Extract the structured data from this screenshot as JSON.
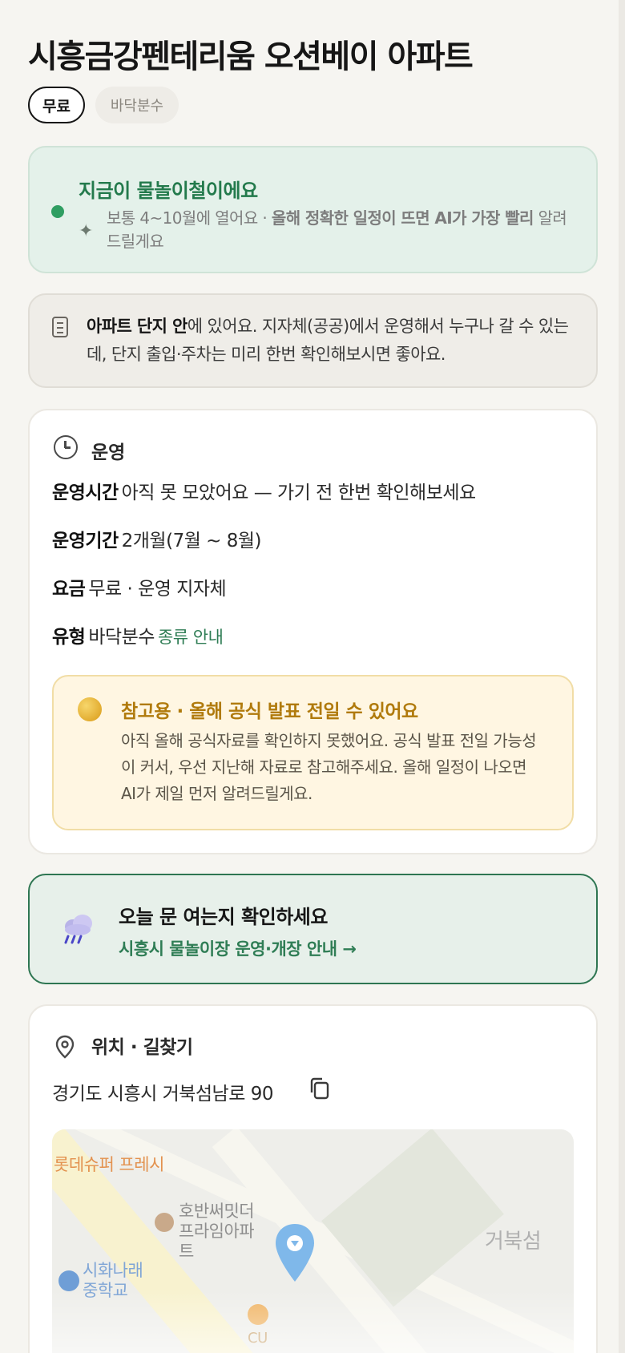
{
  "place": {
    "title": "시흥금강펜테리움 오션베이 아파트",
    "chips": {
      "price": "무료",
      "type": "바닥분수"
    }
  },
  "season": {
    "title": "지금이 물놀이철이에요",
    "text_normal": "보통 4~10월에 열어요 · ",
    "text_bold": "올해 정확한 일정이 뜨면 AI가 가장 빨리",
    "text_rest": " 알려드릴게요"
  },
  "complex": {
    "bold": "아파트 단지 안",
    "text": "에 있어요. 지자체(공공)에서 운영해서 누구나 갈 수 있는데, 단지 출입·주차는 미리 한번 확인해보시면 좋아요."
  },
  "operation": {
    "heading": "운영",
    "hours_label": "운영시간",
    "hours_value": "아직 못 모았어요 — 가기 전 한번 확인해보세요",
    "period_label": "운영기간",
    "period_value": "2개월(7월 ~ 8월)",
    "fee_label": "요금",
    "fee_value": "무료 · 운영 지자체",
    "type_label": "유형",
    "type_value": "바닥분수",
    "type_link": "종류 안내"
  },
  "notice": {
    "title": "참고용 · 올해 공식 발표 전일 수 있어요",
    "text": "아직 올해 공식자료를 확인하지 못했어요. 공식 발표 전일 가능성이 커서, 우선 지난해 자료로 참고해주세요. 올해 일정이 나오면 AI가 제일 먼저 알려드릴게요."
  },
  "cta": {
    "title": "오늘 문 여는지 확인하세요",
    "link": "시흥시 물놀이장 운영·개장 안내 →"
  },
  "location": {
    "heading": "위치 · 길찾기",
    "address": "경기도 시흥시 거북섬남로 90",
    "map_labels": {
      "lotte": "롯데슈퍼 프레시",
      "apt": "호반써밋더 프라임아파트",
      "school": "시화나래 중학교",
      "right": "거북섬",
      "bottom": "CU"
    }
  }
}
